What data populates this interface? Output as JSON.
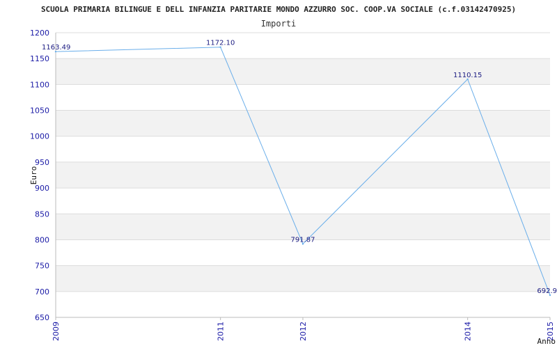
{
  "chart_data": {
    "type": "line",
    "title": "SCUOLA PRIMARIA BILINGUE E DELL INFANZIA PARITARIE MONDO AZZURRO SOC. COOP.VA SOCIALE (c.f.03142470925)",
    "subtitle": "Importi",
    "xlabel": "Anno",
    "ylabel": "Euro",
    "x": [
      2009,
      2011,
      2012,
      2014,
      2015
    ],
    "xlim": [
      2009,
      2015
    ],
    "ylim": [
      650,
      1200
    ],
    "yticks": [
      650,
      700,
      750,
      800,
      850,
      900,
      950,
      1000,
      1050,
      1100,
      1150,
      1200
    ],
    "series": [
      {
        "values": [
          1163.49,
          1172.1,
          791.87,
          1110.15,
          692.9
        ],
        "labels": [
          "1163.49",
          "1172.10",
          "791.87",
          "1110.15",
          "692.9"
        ]
      }
    ],
    "grid": true,
    "line_color": "#6aaeea",
    "band_color": "#f2f2f2",
    "tick_color": "#1a1aa6"
  }
}
